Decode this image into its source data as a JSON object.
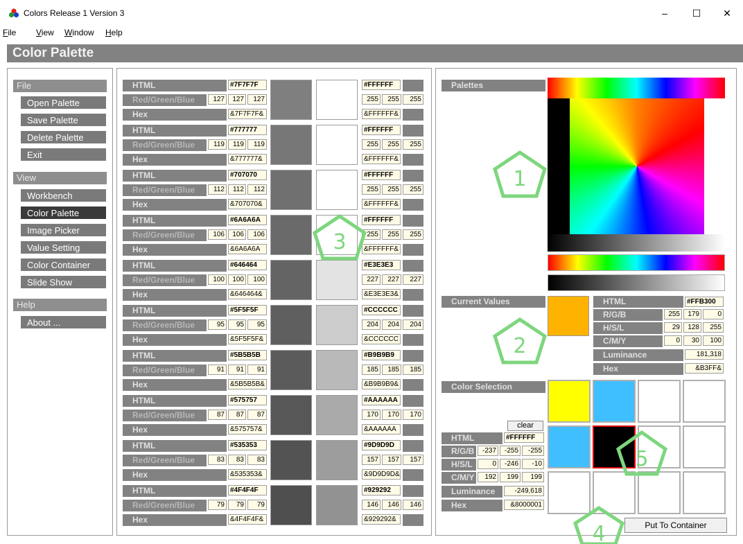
{
  "window": {
    "title": "Colors Release 1 Version 3",
    "minimize": "–",
    "maximize": "☐",
    "close": "✕"
  },
  "menu": [
    "File",
    "View",
    "Window",
    "Help"
  ],
  "banner": "Color Palette",
  "sidebar": {
    "sections": [
      {
        "title": "File",
        "items": [
          "Open Palette",
          "Save Palette",
          "Delete Palette",
          "Exit"
        ]
      },
      {
        "title": "View",
        "items": [
          "Workbench",
          "Color Palette",
          "Image Picker",
          "Value Setting",
          "Color Container",
          "Slide Show"
        ]
      },
      {
        "title": "Help",
        "items": [
          "About ..."
        ]
      }
    ],
    "active": "Color Palette"
  },
  "palette_labels": {
    "html": "HTML",
    "rgb": "Red/Green/Blue",
    "hex": "Hex"
  },
  "palette_rows": [
    {
      "html": "#7F7F7F",
      "r": "127",
      "g": "127",
      "b": "127",
      "hex": "&7F7F7F&",
      "color": "#7f7f7f",
      "html2": "#FFFFFF",
      "r2": "255",
      "g2": "255",
      "b2": "255",
      "hex2": "&FFFFFF&",
      "color2": "#ffffff"
    },
    {
      "html": "#777777",
      "r": "119",
      "g": "119",
      "b": "119",
      "hex": "&777777&",
      "color": "#777777",
      "html2": "#FFFFFF",
      "r2": "255",
      "g2": "255",
      "b2": "255",
      "hex2": "&FFFFFF&",
      "color2": "#ffffff"
    },
    {
      "html": "#707070",
      "r": "112",
      "g": "112",
      "b": "112",
      "hex": "&707070&",
      "color": "#707070",
      "html2": "#FFFFFF",
      "r2": "255",
      "g2": "255",
      "b2": "255",
      "hex2": "&FFFFFF&",
      "color2": "#ffffff"
    },
    {
      "html": "#6A6A6A",
      "r": "106",
      "g": "106",
      "b": "106",
      "hex": "&6A6A6A",
      "color": "#6a6a6a",
      "html2": "#FFFFFF",
      "r2": "255",
      "g2": "255",
      "b2": "255",
      "hex2": "&FFFFFF&",
      "color2": "#ffffff"
    },
    {
      "html": "#646464",
      "r": "100",
      "g": "100",
      "b": "100",
      "hex": "&646464&",
      "color": "#646464",
      "html2": "#E3E3E3",
      "r2": "227",
      "g2": "227",
      "b2": "227",
      "hex2": "&E3E3E3&",
      "color2": "#e3e3e3"
    },
    {
      "html": "#5F5F5F",
      "r": "95",
      "g": "95",
      "b": "95",
      "hex": "&5F5F5F&",
      "color": "#5f5f5f",
      "html2": "#CCCCCC",
      "r2": "204",
      "g2": "204",
      "b2": "204",
      "hex2": "&CCCCCC",
      "color2": "#cccccc"
    },
    {
      "html": "#5B5B5B",
      "r": "91",
      "g": "91",
      "b": "91",
      "hex": "&5B5B5B&",
      "color": "#5b5b5b",
      "html2": "#B9B9B9",
      "r2": "185",
      "g2": "185",
      "b2": "185",
      "hex2": "&B9B9B9&",
      "color2": "#b9b9b9"
    },
    {
      "html": "#575757",
      "r": "87",
      "g": "87",
      "b": "87",
      "hex": "&575757&",
      "color": "#575757",
      "html2": "#AAAAAA",
      "r2": "170",
      "g2": "170",
      "b2": "170",
      "hex2": "&AAAAAA",
      "color2": "#aaaaaa"
    },
    {
      "html": "#535353",
      "r": "83",
      "g": "83",
      "b": "83",
      "hex": "&535353&",
      "color": "#535353",
      "html2": "#9D9D9D",
      "r2": "157",
      "g2": "157",
      "b2": "157",
      "hex2": "&9D9D9D&",
      "color2": "#9d9d9d"
    },
    {
      "html": "#4F4F4F",
      "r": "79",
      "g": "79",
      "b": "79",
      "hex": "&4F4F4F&",
      "color": "#4f4f4f",
      "html2": "#929292",
      "r2": "146",
      "g2": "146",
      "b2": "146",
      "hex2": "&929292&",
      "color2": "#929292"
    }
  ],
  "palettes_title": "Palettes",
  "current": {
    "title": "Current Values",
    "swatch": "#ffb300",
    "labels": {
      "html": "HTML",
      "rgb": "R/G/B",
      "hsl": "H/S/L",
      "cmy": "C/M/Y",
      "lum": "Luminance",
      "hex": "Hex"
    },
    "html": "#FFB300",
    "rgb": [
      "255",
      "179",
      "0"
    ],
    "hsl": [
      "29",
      "128",
      "255"
    ],
    "cmy": [
      "0",
      "30",
      "100"
    ],
    "lum": "181,318",
    "hex": "&B3FF&"
  },
  "selection": {
    "title": "Color Selection",
    "clear": "clear",
    "labels": {
      "html": "HTML",
      "rgb": "R/G/B",
      "hsl": "H/S/L",
      "cmy": "C/M/Y",
      "lum": "Luminance",
      "hex": "Hex"
    },
    "html": "#FFFFFF",
    "rgb": [
      "-237",
      "-255",
      "-255"
    ],
    "hsl": [
      "0",
      "-246",
      "-10"
    ],
    "cmy": [
      "192",
      "199",
      "199"
    ],
    "lum": "-249,618",
    "hex": "&8000001",
    "put": "Put To Container",
    "cells": [
      "#ffff00",
      "#3fbfff",
      "#ffffff",
      "#ffffff",
      "#3fbfff",
      "#000000",
      "#ffffff",
      "#ffffff",
      "#ffffff",
      "#ffffff",
      "#ffffff",
      "#ffffff"
    ],
    "selected_index": 5
  },
  "markers": [
    "1",
    "2",
    "3",
    "4",
    "5"
  ],
  "colors": {
    "panel_label": "#828282",
    "value_bg": "#fffbe6",
    "marker": "#7ed67e",
    "selected": "#e00000"
  }
}
